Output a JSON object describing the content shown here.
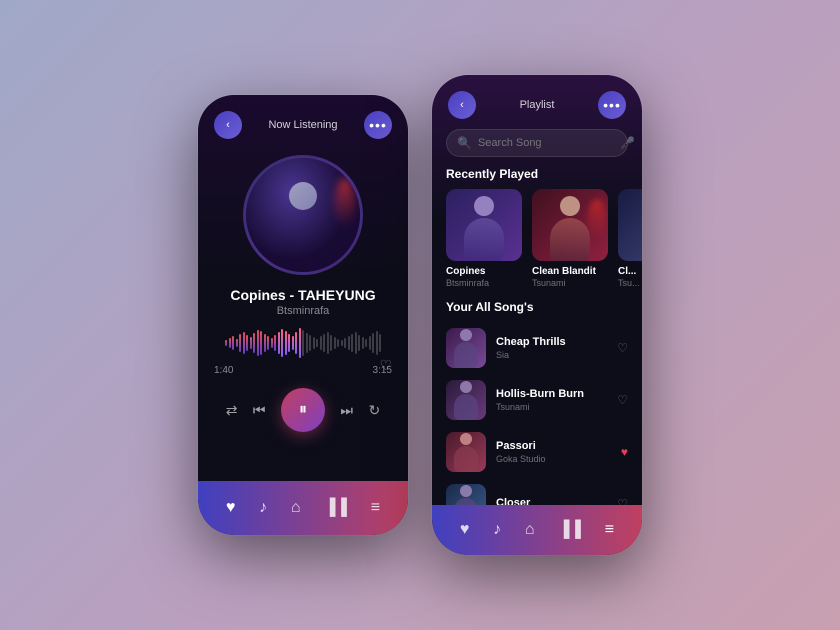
{
  "left_phone": {
    "header": {
      "back_label": "‹",
      "title": "Now Listening",
      "more_label": "•••"
    },
    "song": {
      "title": "Copines - TAHEYUNG",
      "artist": "Btsminrafa"
    },
    "time": {
      "current": "1:40",
      "total": "3:15"
    },
    "controls": {
      "shuffle": "⇄",
      "prev": "⏮",
      "pause": "⏸",
      "next": "⏭",
      "repeat": "↻"
    },
    "nav_icons": [
      "♥",
      "♪",
      "⌂",
      "▐▐",
      "≡"
    ]
  },
  "right_phone": {
    "header": {
      "back_label": "‹",
      "title": "Playlist",
      "more_label": "•••"
    },
    "search": {
      "placeholder": "Search Song",
      "icon": "🔍",
      "mic_icon": "🎤"
    },
    "recently_played": {
      "label": "Recently Played",
      "items": [
        {
          "name": "Copines",
          "artist": "Btsminrafa"
        },
        {
          "name": "Clean Blandit",
          "artist": "Tsunami"
        },
        {
          "name": "Cl...",
          "artist": "Tsu..."
        }
      ]
    },
    "all_songs": {
      "label": "Your All Song's",
      "items": [
        {
          "title": "Cheap Thrills",
          "artist": "Sia",
          "liked": false
        },
        {
          "title": "Hollis-Burn Burn",
          "artist": "Tsunami",
          "liked": false
        },
        {
          "title": "Passori",
          "artist": "Goka Studio",
          "liked": true
        },
        {
          "title": "Closer",
          "artist": "",
          "liked": false
        }
      ]
    },
    "nav_icons": [
      "♥",
      "♪",
      "⌂",
      "▐▐",
      "≡"
    ]
  }
}
